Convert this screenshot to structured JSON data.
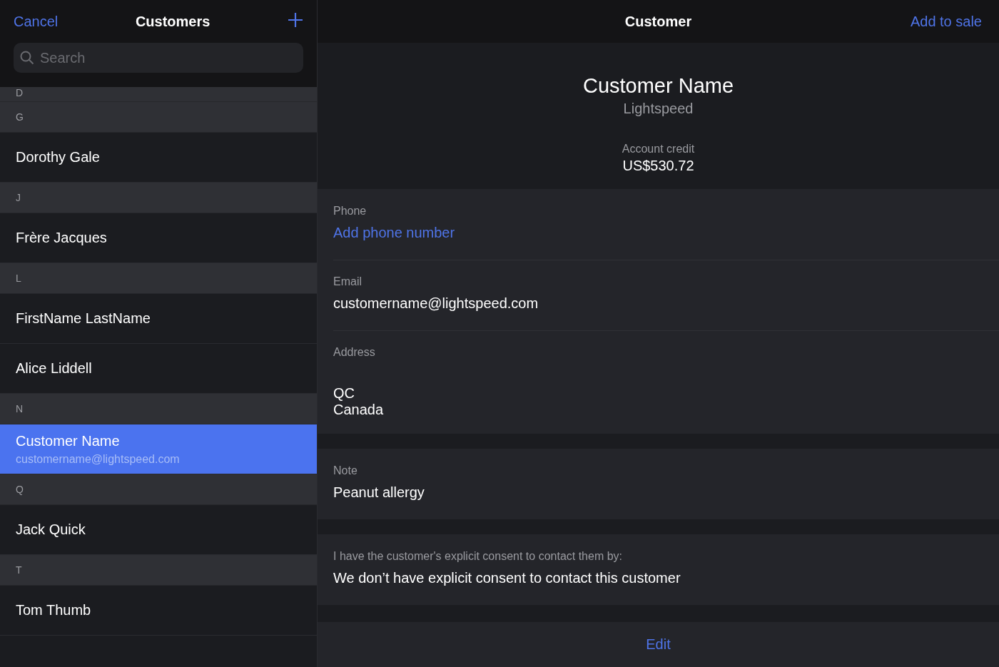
{
  "sidebar": {
    "cancel": "Cancel",
    "title": "Customers",
    "search": {
      "placeholder": "Search"
    },
    "sections": [
      {
        "letter": "D"
      },
      {
        "letter": "G",
        "customers": [
          {
            "name": "Dorothy Gale",
            "selected": false
          }
        ]
      },
      {
        "letter": "J",
        "customers": [
          {
            "name": "Frère Jacques",
            "selected": false
          }
        ]
      },
      {
        "letter": "L",
        "customers": [
          {
            "name": "FirstName LastName",
            "selected": false
          },
          {
            "name": "Alice Liddell",
            "selected": false
          }
        ]
      },
      {
        "letter": "N",
        "customers": [
          {
            "name": "Customer Name",
            "email": "customername@lightspeed.com",
            "selected": true
          }
        ]
      },
      {
        "letter": "Q",
        "customers": [
          {
            "name": "Jack Quick",
            "selected": false
          }
        ]
      },
      {
        "letter": "T",
        "customers": [
          {
            "name": "Tom Thumb",
            "selected": false
          }
        ]
      }
    ]
  },
  "detail": {
    "title": "Customer",
    "action": "Add to sale",
    "name": "Customer Name",
    "company": "Lightspeed",
    "credit_label": "Account credit",
    "credit": "US$530.72",
    "groups": [
      [
        {
          "label": "Phone",
          "value": "Add phone number",
          "kind": "link"
        },
        {
          "label": "Email",
          "value": "customername@lightspeed.com",
          "kind": "text"
        },
        {
          "label": "Address",
          "lines": [
            "QC",
            "Canada"
          ],
          "kind": "address"
        }
      ],
      [
        {
          "label": "Note",
          "value": "Peanut allergy",
          "kind": "text"
        }
      ],
      [
        {
          "label": "I have the customer's explicit consent to contact them by:",
          "value": "We don’t have explicit consent to contact this customer",
          "kind": "text"
        }
      ]
    ],
    "edit": "Edit"
  }
}
